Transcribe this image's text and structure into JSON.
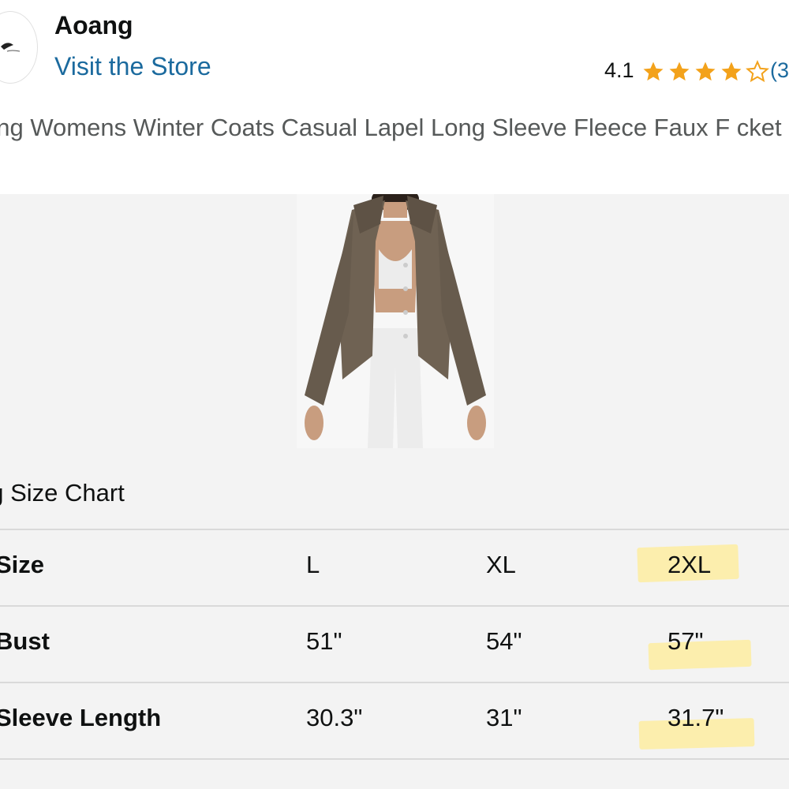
{
  "header": {
    "brand": "Aoang",
    "visit_store": "Visit the Store",
    "rating": "4.1",
    "rating_count": "(3",
    "stars_filled": 4,
    "stars_total": 5
  },
  "product": {
    "title": "ang Womens Winter Coats Casual Lapel Long Sleeve Fleece Faux F cket",
    "image_alt": "woman wearing brown fleece jacket",
    "jacket_color": "#6f6253"
  },
  "size_chart": {
    "title": "ng Size Chart",
    "rows": [
      {
        "label": "Size",
        "values": [
          "L",
          "XL",
          "2XL"
        ]
      },
      {
        "label": "Bust",
        "values": [
          "51\"",
          "54\"",
          "57\""
        ]
      },
      {
        "label": "Sleeve Length",
        "values": [
          "30.3\"",
          "31\"",
          "31.7\""
        ]
      }
    ],
    "highlighted_column": "2XL"
  },
  "colors": {
    "link": "#1b6a9e",
    "star": "#f3a21b",
    "highlight": "#ffec96",
    "panel": "#f3f3f3"
  }
}
